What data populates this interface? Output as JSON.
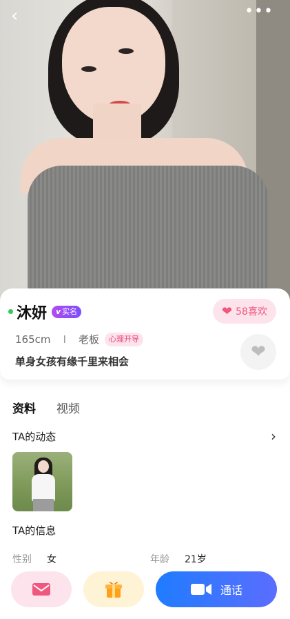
{
  "header": {
    "back_icon": "back-arrow-icon",
    "more_icon": "more-dots-icon"
  },
  "profile": {
    "name": "沐妍",
    "verify_badge": "实名",
    "likes": "58喜欢",
    "height": "165cm",
    "separator": "I",
    "occupation": "老板",
    "tag": "心理开导",
    "bio": "单身女孩有缘千里来相会"
  },
  "tabs": [
    {
      "label": "资料"
    },
    {
      "label": "视频"
    }
  ],
  "sections": {
    "moments_title": "TA的动态",
    "info_title": "TA的信息",
    "info_gender_label": "性别",
    "info_gender_value": "女",
    "info_age_label": "年龄",
    "info_age_value": "21岁"
  },
  "actions": {
    "call_label": "通话"
  },
  "colors": {
    "accent_blue": "#1f7cff",
    "accent_pink": "#f0577f",
    "verify_purple": "#8b4dff"
  }
}
